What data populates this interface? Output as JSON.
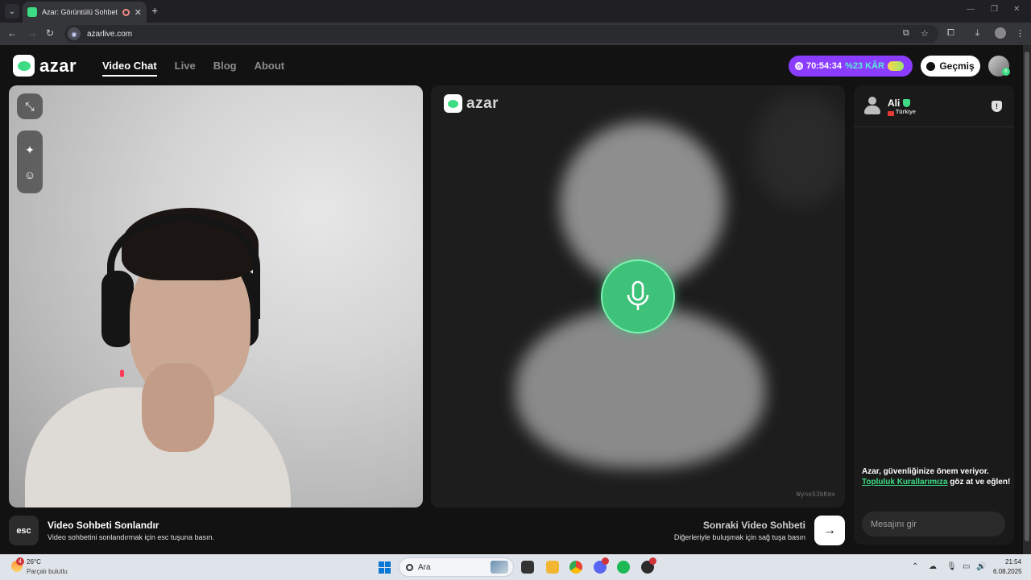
{
  "browser": {
    "tab_title": "Azar: Görüntülü Sohbet, Ar",
    "url": "azarlive.com",
    "icons": [
      "tab-search-icon",
      "back-icon",
      "forward-icon",
      "reload-icon",
      "site-info-icon",
      "install-icon",
      "bookmark-star-icon",
      "extensions-icon",
      "download-icon",
      "menu-kebab-icon"
    ]
  },
  "header": {
    "logo_text": "azar",
    "nav": [
      {
        "label": "Video Chat",
        "active": true
      },
      {
        "label": "Live",
        "active": false
      },
      {
        "label": "Blog",
        "active": false
      },
      {
        "label": "About",
        "active": false
      }
    ],
    "timer": "70:54:34",
    "profit": "%23 KÂR",
    "history_label": "Geçmiş",
    "avatar_badge": "6"
  },
  "partner": {
    "logo_text": "azar",
    "id": "Wyno53bKmx"
  },
  "bottom": {
    "esc_key": "esc",
    "end_title": "Video Sohbeti Sonlandır",
    "end_desc": "Video sohbetini sonlandırmak için esc tuşuna basın.",
    "next_title": "Sonraki Video Sohbeti",
    "next_desc": "Diğerleriyle buluşmak için sağ tuşa basın",
    "next_arrow": "→"
  },
  "chat": {
    "name": "Ali",
    "country": "Türkiye",
    "report": "!",
    "safety_text_1": "Azar, güvenliğinize önem veriyor.",
    "safety_link": "Topluluk Kurallarımıza",
    "safety_text_2": "göz at ve eğlen!",
    "input_placeholder": "Mesajını gir"
  },
  "taskbar": {
    "weather_badge": "4",
    "temp": "26°C",
    "weather_desc": "Parçalı bulutlu",
    "search_placeholder": "Ara",
    "time": "21:54",
    "date": "6.08.2025"
  },
  "colors": {
    "accent_green": "#3ddc84",
    "timer_purple": "#8b3dff",
    "mic_green": "#3ec27a"
  }
}
